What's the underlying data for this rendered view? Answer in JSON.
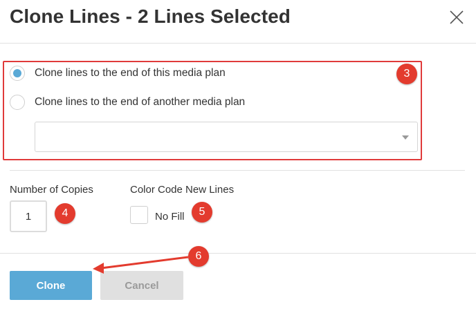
{
  "dialog": {
    "title": "Clone Lines - 2 Lines Selected"
  },
  "options": {
    "items": [
      {
        "label": "Clone lines to the end of this media plan",
        "selected": true
      },
      {
        "label": "Clone lines to the end of another media plan",
        "selected": false
      }
    ],
    "media_plan_select": {
      "value": ""
    }
  },
  "copies": {
    "label": "Number of Copies",
    "value": "1"
  },
  "color_code": {
    "label": "Color Code New Lines",
    "checkbox_label": "No Fill",
    "checked": false
  },
  "buttons": {
    "clone_label": "Clone",
    "cancel_label": "Cancel"
  },
  "annotations": {
    "badges": [
      "3",
      "4",
      "5",
      "6"
    ],
    "color": "#e33b2e"
  },
  "colors": {
    "accent": "#5aa9d6",
    "highlight_border": "#e03a3a"
  }
}
